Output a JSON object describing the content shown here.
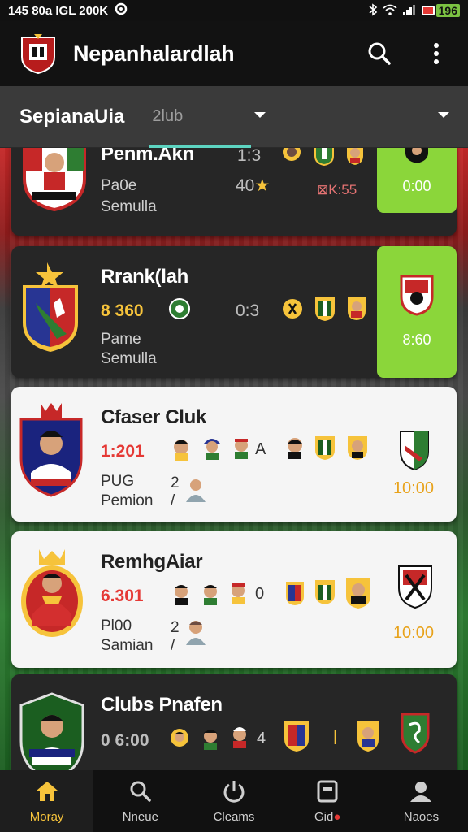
{
  "status_bar": {
    "time_text": "145 80a IGL 200K",
    "battery_text": "196"
  },
  "app_bar": {
    "title": "Nepanhalardlah"
  },
  "filter_bar": {
    "primary": "SepianaUia",
    "secondary": "2lub"
  },
  "cards": [
    {
      "name": "Penm.Akn",
      "sub1": "Pa0e",
      "sub2": "Semulla",
      "score_mid": "1:3",
      "score_mid2": "40",
      "extra": "K:55",
      "time": "0:00",
      "theme": "dark"
    },
    {
      "name": "Rrank(lah",
      "score_red": "8 360",
      "sub1": "Pame",
      "sub2": "Semulla",
      "score_mid": "0:3",
      "time": "8:60",
      "theme": "dark"
    },
    {
      "name": "Cfaser Cluk",
      "score_red": "1:201",
      "sub1": "PUG",
      "sub2": "Pemion",
      "count": "2",
      "letter": "A",
      "time": "10:00",
      "theme": "light"
    },
    {
      "name": "RemhgAiar",
      "score_red": "6.301",
      "sub1": "Pl00",
      "sub2": "Samian",
      "count": "2",
      "letter": "0",
      "time": "10:00",
      "theme": "light"
    },
    {
      "name": "Clubs Pnafen",
      "score_red": "0 6:00",
      "count": "4",
      "theme": "dark"
    }
  ],
  "bottom_nav": [
    {
      "label": "Moray",
      "icon": "home-icon",
      "active": true
    },
    {
      "label": "Nneue",
      "icon": "search-icon"
    },
    {
      "label": "Cleams",
      "icon": "power-icon"
    },
    {
      "label": "Gid",
      "icon": "calendar-icon"
    },
    {
      "label": "Naoes",
      "icon": "profile-icon"
    }
  ],
  "colors": {
    "accent_green": "#8bd63a",
    "tab_underline": "#5dd4c1",
    "score_red": "#e53935",
    "time_gold": "#e8a21a",
    "nav_active": "#f6c33b"
  }
}
